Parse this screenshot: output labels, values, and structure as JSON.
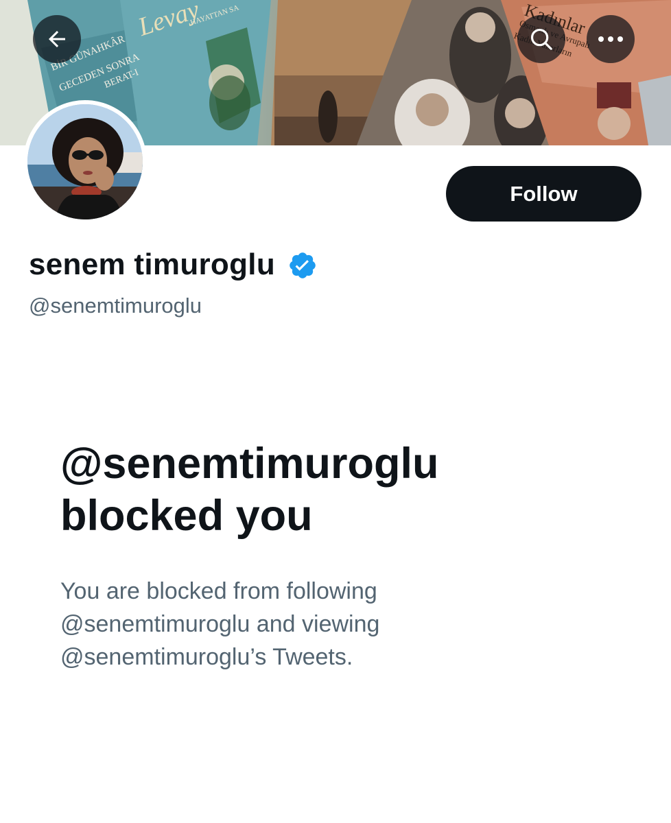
{
  "header": {
    "banner_texts": {
      "book1_line1": "BİR GÜNAHKÂR",
      "book1_line2": "GECEDEN SONRA",
      "book1_line3": "BERAT-I",
      "book2_title": "Levay",
      "book2_sub": "HAYATTAN SA",
      "book4_title": "Kadınlar",
      "book4_line1": "Osmanlı ve Avrupalı",
      "book4_line2": "Kadın Yazarların"
    },
    "back_icon": "arrow-left-icon",
    "search_icon": "search-icon",
    "more_icon": "more-horizontal-icon"
  },
  "profile": {
    "follow_label": "Follow",
    "display_name": "senem timuroglu",
    "verified_icon": "verified-badge-icon",
    "handle": "@senemtimuroglu"
  },
  "blocked": {
    "title_line1": "@senemtimuroglu",
    "title_line2": "blocked you",
    "body_line1": "You are blocked from following",
    "body_line2": "@senemtimuroglu and viewing",
    "body_line3": "@senemtimuroglu’s Tweets."
  },
  "colors": {
    "text_primary": "#0f1419",
    "text_secondary": "#536471",
    "verified_blue": "#1d9bf0",
    "button_dark": "#0f1419"
  }
}
